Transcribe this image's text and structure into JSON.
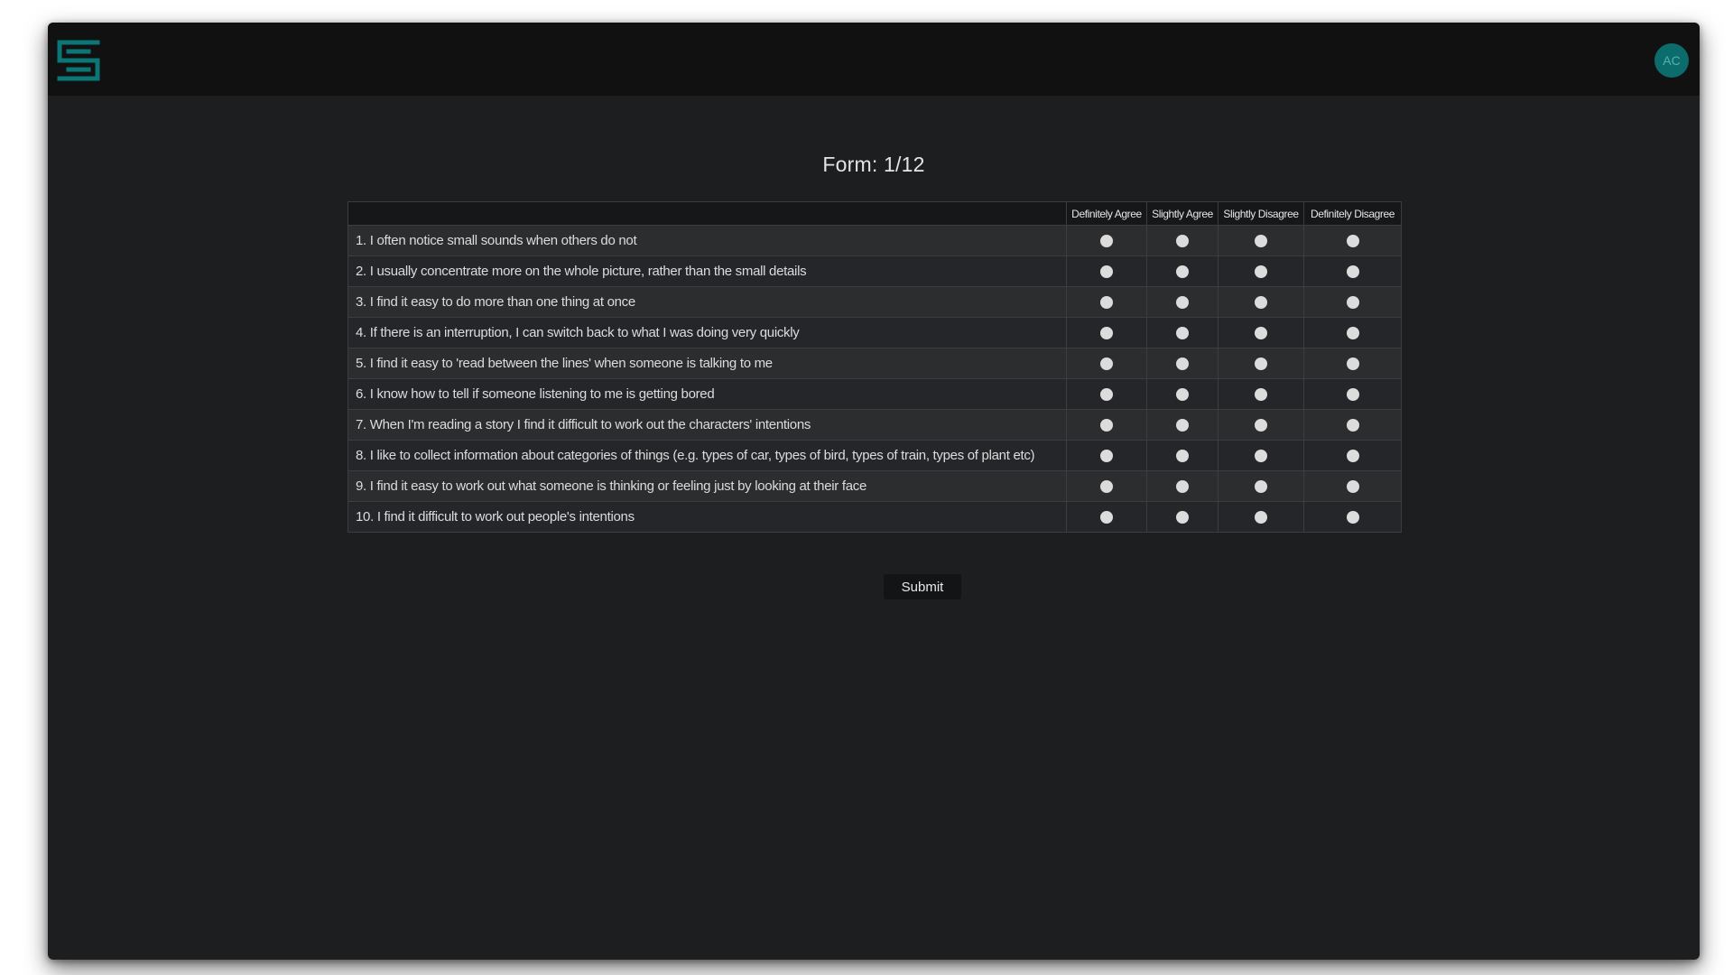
{
  "header": {
    "logo_icon": "maze-s-logo-icon",
    "avatar_initials": "AC",
    "accent_color": "#0c7575"
  },
  "form": {
    "title": "Form: 1/12",
    "columns": [
      "Definitely Agree",
      "Slightly Agree",
      "Slightly Disagree",
      "Definitely Disagree"
    ],
    "questions": [
      "1. I often notice small sounds when others do not",
      "2. I usually concentrate more on the whole picture, rather than the small details",
      "3. I find it easy to do more than one thing at once",
      "4. If there is an interruption, I can switch back to what I was doing very quickly",
      "5. I find it easy to 'read between the lines' when someone is talking to me",
      "6. I know how to tell if someone listening to me is getting bored",
      "7. When I'm reading a story I find it difficult to work out the characters' intentions",
      "8. I like to collect information about categories of things (e.g. types of car, types of bird, types of train, types of plant etc)",
      "9. I find it easy to work out what someone is thinking or feeling just by looking at their face",
      "10. I find it difficult to work out people's intentions"
    ],
    "submit_label": "Submit"
  }
}
